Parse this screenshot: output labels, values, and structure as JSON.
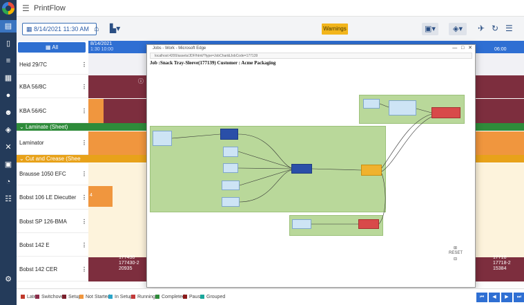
{
  "app": {
    "title": "PrintFlow"
  },
  "toolbar": {
    "date_label": "8/14/2021 11:30 AM",
    "warnings_label": "Warnings"
  },
  "resource_panel": {
    "all_label": "All",
    "rows": [
      {
        "label": "Heid 29/7C"
      },
      {
        "label": "KBA 56/8C"
      },
      {
        "label": "KBA 56/6C"
      },
      {
        "label": "Laminator"
      },
      {
        "label": "Brausse 1050 EFC"
      },
      {
        "label": "Bobst 106 LE Diecutter"
      },
      {
        "label": "Bobst SP 126-BMA"
      },
      {
        "label": "Bobst 142 E"
      },
      {
        "label": "Bobst 142 CER"
      }
    ],
    "groups": [
      {
        "label": "Laminate (Sheet)",
        "color": "#2e8b3a"
      },
      {
        "label": "Cut and Crease (Shee",
        "color": "#e8a21a"
      }
    ]
  },
  "gantt": {
    "date_header": "8/14/2021",
    "time_left": "1:30 10:00",
    "time_right": "06:00",
    "bar_labels": {
      "r1": "177430",
      "r2": "177430-2",
      "r3": "20935",
      "l1": "17718",
      "l2": "17718-2",
      "l3": "15384",
      "d4": "4"
    }
  },
  "legend": [
    {
      "label": "Late",
      "color": "#c0392b"
    },
    {
      "label": "Switchover",
      "color": "#8b2d4a"
    },
    {
      "label": "Setup",
      "color": "#7a1f2b"
    },
    {
      "label": "Not Started",
      "color": "#f0963e"
    },
    {
      "label": "In Setup",
      "color": "#2aa5c9"
    },
    {
      "label": "Running",
      "color": "#c23a3a"
    },
    {
      "label": "Completed",
      "color": "#2e8b3a"
    },
    {
      "label": "Pause",
      "color": "#8b1a1a"
    },
    {
      "label": "Grouped",
      "color": "#1aa79c"
    }
  ],
  "popup": {
    "window_title": "Jobs - Work - Microsoft Edge",
    "url": "localhost:4200/assets/JDF/html/?type=JobChart&JobCode=177139",
    "heading": "Job :Snack Tray-Sleeve(177139) Customer : Acme Packaging",
    "reset_label": "RESET"
  },
  "colors": {
    "primary": "#2f6fd3",
    "sidebar": "#243b5a",
    "maroon": "#7d2e3e",
    "orange": "#f0963e"
  }
}
